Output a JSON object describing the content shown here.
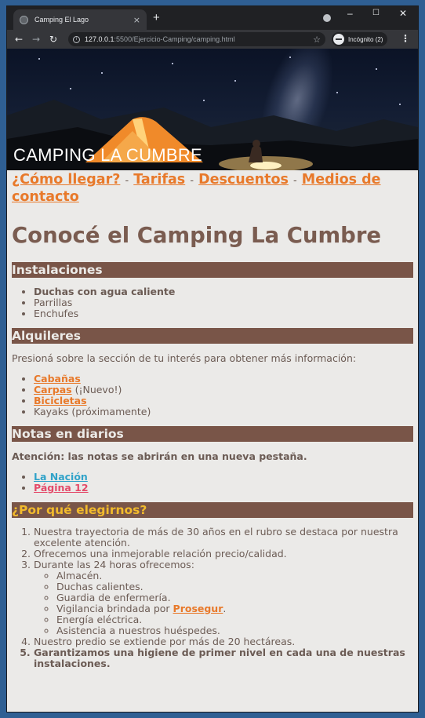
{
  "browser": {
    "tab_title": "Camping El Lago",
    "tab_close": "×",
    "new_tab": "+",
    "url_host": "127.0.0.1",
    "url_path": ":5500/Ejercicio-Camping/camping.html",
    "incognito_label": "Incógnito (2)",
    "win_min": "–",
    "win_max": "☐",
    "win_close": "✕",
    "back": "←",
    "forward": "→",
    "reload": "↻",
    "star": "☆",
    "menu": "⋮",
    "info": "i"
  },
  "header": {
    "title": "CAMPING LA CUMBRE"
  },
  "nav": {
    "items": [
      {
        "label": "¿Cómo llegar?"
      },
      {
        "label": "Tarifas"
      },
      {
        "label": "Descuentos"
      },
      {
        "label": "Medios de contacto"
      }
    ],
    "separator": "-"
  },
  "main": {
    "title": "Conocé el Camping La Cumbre",
    "instalaciones": {
      "heading": "Instalaciones",
      "items": [
        "Duchas con agua caliente",
        "Parrillas",
        "Enchufes"
      ]
    },
    "alquileres": {
      "heading": "Alquileres",
      "intro": "Presioná sobre la sección de tu interés para obtener más información:",
      "items": [
        {
          "link": "Cabañas",
          "suffix": ""
        },
        {
          "link": "Carpas",
          "suffix": " (¡Nuevo!)"
        },
        {
          "link": "Bicicletas",
          "suffix": ""
        },
        {
          "link": "",
          "suffix": "Kayaks (próximamente)"
        }
      ]
    },
    "notas": {
      "heading": "Notas en diarios",
      "warning": "Atención: las notas se abrirán en una nueva pestaña.",
      "links": [
        "La Nación",
        "Página 12"
      ]
    },
    "porque": {
      "heading": "¿Por qué elegirnos?",
      "item1": "Nuestra trayectoria de más de 30 años en el rubro se destaca por nuestra excelente atención.",
      "item2": "Ofrecemos una inmejorable relación precio/calidad.",
      "item3": "Durante las 24 horas ofrecemos:",
      "sub": [
        "Almacén.",
        "Duchas calientes.",
        "Guardia de enfermería."
      ],
      "vigilancia_pre": "Vigilancia brindada por ",
      "vigilancia_link": "Prosegur",
      "vigilancia_post": ".",
      "sub2": [
        "Energía eléctrica.",
        "Asistencia a nuestros huéspedes."
      ],
      "item4": "Nuestro predio se extiende por más de 20 hectáreas.",
      "item5": "Garantizamos una higiene de primer nivel en cada una de nuestras instalaciones."
    }
  },
  "colors": {
    "accent": "#e8792a",
    "heading_bg": "#795548",
    "text": "#6b5b54",
    "gold": "#f2bb2c",
    "link_blue": "#31a3c9",
    "link_pink": "#e44b6a"
  }
}
